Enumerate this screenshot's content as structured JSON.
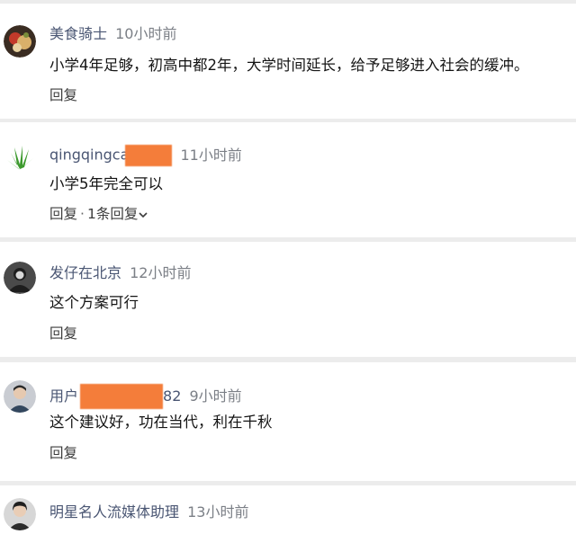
{
  "comments": [
    {
      "avatar_icon": "food-knight-avatar-icon",
      "username": "美食骑士",
      "time": "10小时前",
      "text": "小学4年足够，初高中都2年，大学时间延长，给予足够进入社会的缓冲。",
      "reply_label": "回复"
    },
    {
      "avatar_icon": "grass-avatar-icon",
      "username": "qingqingca",
      "time": "11小时前",
      "text": "小学5年完全可以",
      "reply_label": "回复",
      "reply_count_label": "1条回复",
      "separator": "·"
    },
    {
      "avatar_icon": "person-avatar-icon",
      "username": "发仔在北京",
      "time": "12小时前",
      "text": "这个方案可行",
      "reply_label": "回复"
    },
    {
      "avatar_icon": "person-avatar-icon",
      "username_prefix": "用户",
      "username_suffix": "82",
      "time": "9小时前",
      "text": "这个建议好，功在当代，利在千秋",
      "reply_label": "回复"
    },
    {
      "avatar_icon": "person-avatar-icon",
      "username": "明星名人流媒体助理",
      "time": "13小时前"
    }
  ],
  "colors": {
    "username": "#4a5673",
    "time": "#7b7f86",
    "redaction": "#f47d3a",
    "background": "#ececec"
  }
}
